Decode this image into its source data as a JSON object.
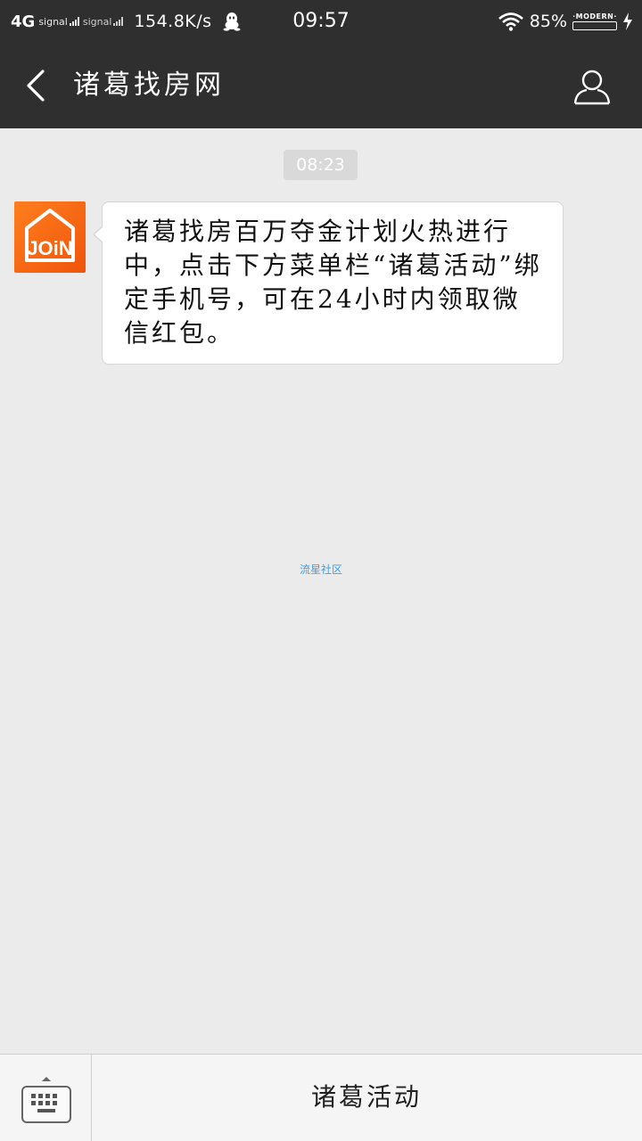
{
  "statusbar": {
    "network": "4G",
    "signal1_label": "signal",
    "signal2_label": "signal",
    "speed": "154.8K/s",
    "time": "09:57",
    "battery_percent": "85%",
    "battery_brand": "·MODERN·",
    "battery_level": 0.85,
    "icons": [
      "qq-icon",
      "wifi-icon",
      "battery-icon",
      "charging-icon"
    ]
  },
  "header": {
    "title": "诸葛找房网",
    "back_icon": "chevron-left-icon",
    "profile_icon": "user-icon"
  },
  "chat": {
    "timestamp": "08:23",
    "avatar_logo_text": "JOiN",
    "message": "诸葛找房百万夺金计划火热进行中，点击下方菜单栏“诸葛活动”绑定手机号，可在24小时内领取微信红包。"
  },
  "watermark": "流星社区",
  "bottom_bar": {
    "keyboard_icon": "keyboard-icon",
    "menu_label": "诸葛活动"
  },
  "colors": {
    "bar_bg": "#2f2f2f",
    "chat_bg": "#ebebeb",
    "avatar_orange": "#f26a10",
    "watermark_blue": "#3aa0e8"
  }
}
